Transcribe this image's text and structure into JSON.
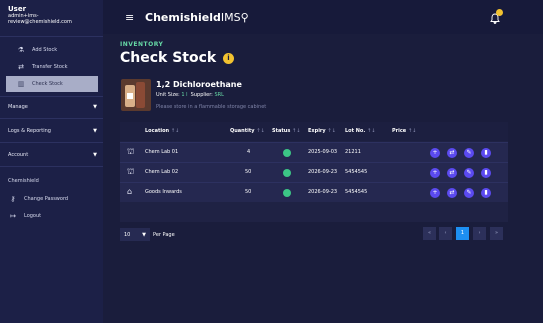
{
  "user": {
    "title": "User",
    "email": "admin+ims-review@chemishield.com"
  },
  "sidebar": {
    "items": [
      {
        "label": "Add Stock",
        "icon": "flask-plus-icon",
        "glyph": "⚗"
      },
      {
        "label": "Transfer Stock",
        "icon": "transfer-icon",
        "glyph": "⇄"
      },
      {
        "label": "Check Stock",
        "icon": "barcode-icon",
        "glyph": "▥"
      }
    ],
    "sections": [
      {
        "label": "Manage"
      },
      {
        "label": "Logs & Reporting"
      },
      {
        "label": "Account"
      }
    ],
    "account_org": "Chemishield",
    "change_password": {
      "label": "Change Password",
      "glyph": "⚷"
    },
    "logout": {
      "label": "Logout",
      "glyph": "↦"
    }
  },
  "topbar": {
    "brand": "Chemishield",
    "brand_suffix": "IMS",
    "brand_glyph": "⚲",
    "menu_glyph": "≡",
    "bell_glyph": "🔔"
  },
  "page": {
    "breadcrumb": "INVENTORY",
    "title": "Check Stock",
    "info_glyph": "i"
  },
  "chemical": {
    "name": "1,2 Dichloroethane",
    "unit_size_label": "Unit Size:",
    "unit_size": "1 l",
    "supplier_label": "Supplier:",
    "supplier": "SRL",
    "note": "Please store in a flammable storage cabinet"
  },
  "table": {
    "sort_glyph": "↑↓",
    "headers": [
      "Location",
      "Quantity",
      "Status",
      "Expiry",
      "Lot No.",
      "Price"
    ],
    "rows": [
      {
        "location": "Chem Lab 01",
        "quantity": "4",
        "expiry": "2025-09-03",
        "lot": "21211",
        "icon": "lab-building-icon",
        "glyph": "⛫"
      },
      {
        "location": "Chem Lab 02",
        "quantity": "50",
        "expiry": "2026-09-23",
        "lot": "5454545",
        "icon": "lab-building-icon",
        "glyph": "⛫"
      },
      {
        "location": "Goods Inwards",
        "quantity": "50",
        "expiry": "2026-09-23",
        "lot": "5454545",
        "icon": "warehouse-icon",
        "glyph": "⌂"
      }
    ],
    "actions": [
      "+",
      "⇄",
      "✎",
      "▮"
    ],
    "status_color": "#3cc686"
  },
  "pagination": {
    "per_page_value": "10",
    "per_page_label": "Per Page",
    "pages": [
      "«",
      "‹",
      "1",
      "›",
      "»"
    ],
    "active_page": "1"
  },
  "colors": {
    "accent": "#66d9a6",
    "action": "#5b4af0",
    "active_page": "#1d8ff2",
    "badge": "#f2c230"
  }
}
